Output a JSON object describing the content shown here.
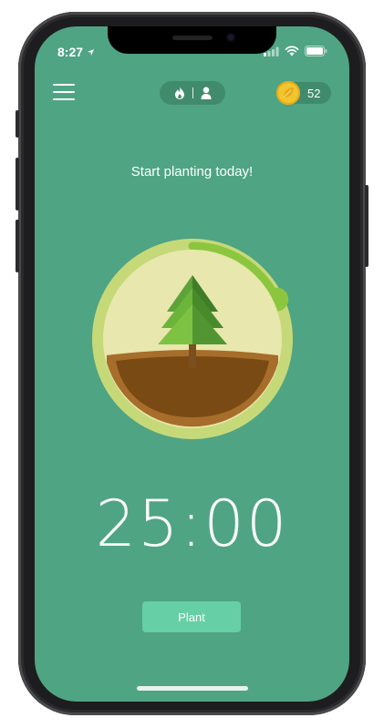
{
  "status_bar": {
    "time": "8:27",
    "signal_icon": "cellular-signal-icon",
    "wifi_icon": "wifi-icon",
    "battery_icon": "battery-icon"
  },
  "header": {
    "menu_icon": "hamburger-menu-icon",
    "mode_icons": [
      "flame-icon",
      "person-icon"
    ],
    "coin_icon": "coin-icon",
    "coins": "52"
  },
  "main": {
    "tagline": "Start planting today!",
    "timer": "25:00",
    "plant_button": "Plant",
    "progress_fraction": 0.18
  },
  "colors": {
    "background": "#4fa483",
    "accent": "#8cc63f",
    "button": "#66cfa5",
    "ring": "#c6d979",
    "disc": "#e8e7ae"
  }
}
